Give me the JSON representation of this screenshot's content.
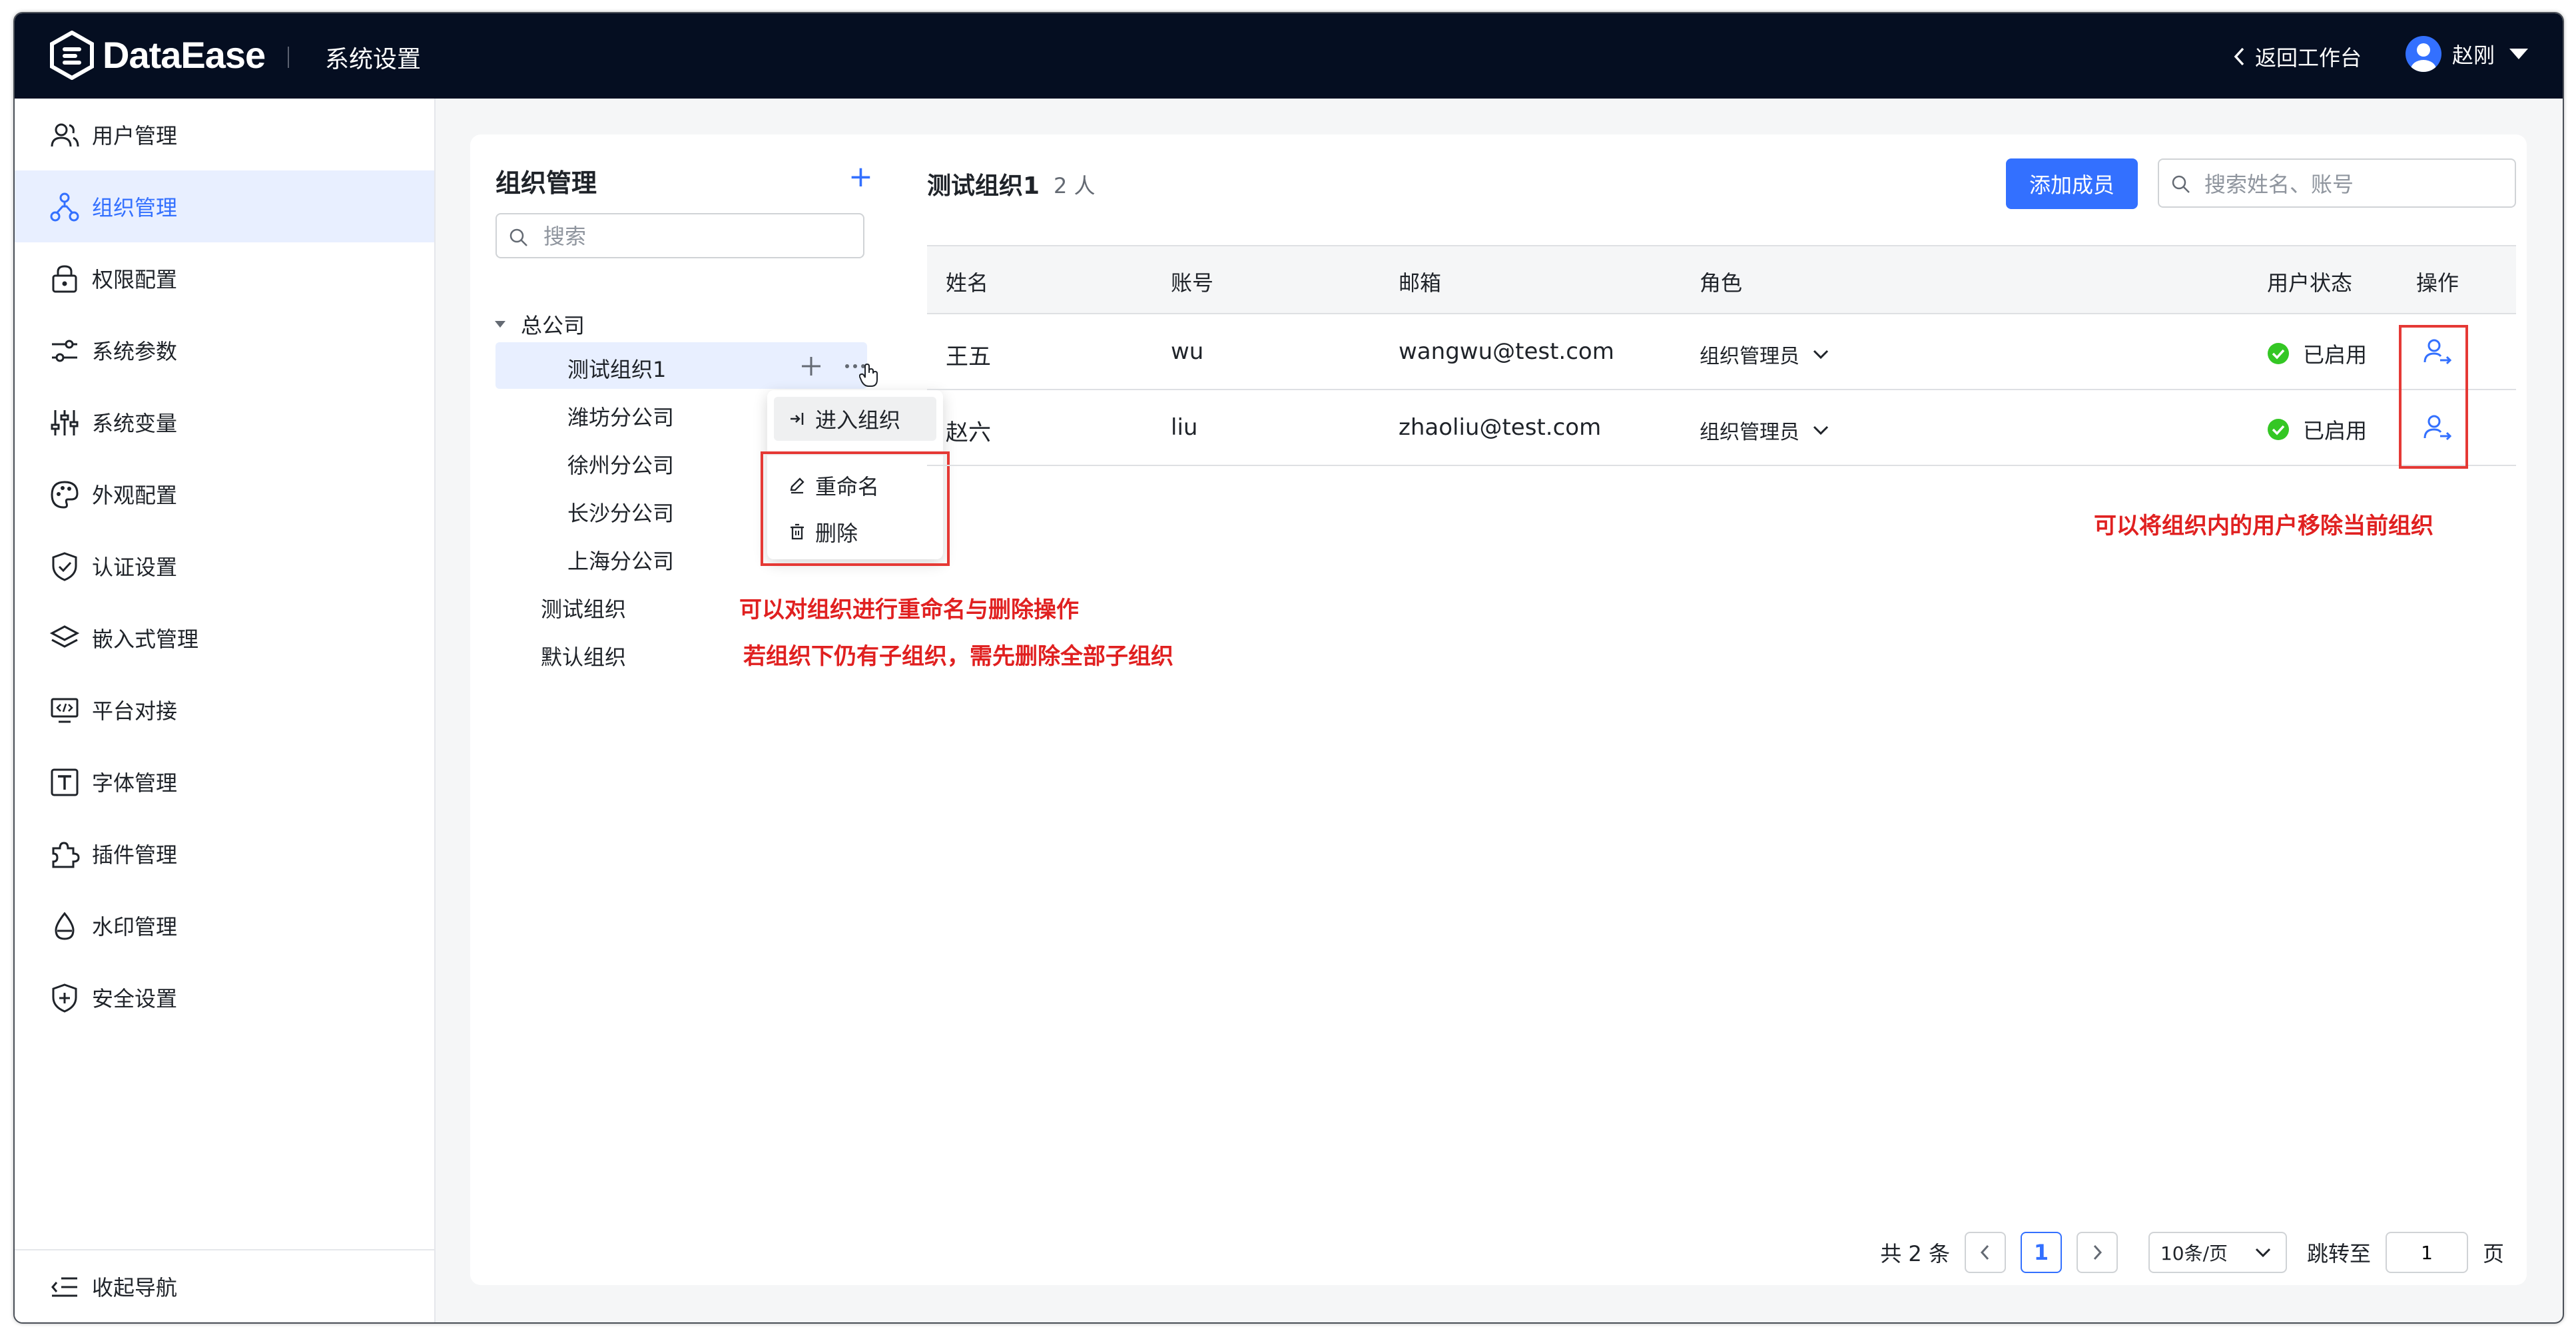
{
  "app": {
    "brand": "DataEase",
    "section_title": "系统设置",
    "back_label": "返回工作台",
    "user_name": "赵刚"
  },
  "sidebar": {
    "items": [
      {
        "label": "用户管理",
        "icon": "users-icon"
      },
      {
        "label": "组织管理",
        "icon": "org-tree-icon",
        "active": true
      },
      {
        "label": "权限配置",
        "icon": "lock-icon"
      },
      {
        "label": "系统参数",
        "icon": "sliders-icon"
      },
      {
        "label": "系统变量",
        "icon": "variables-icon"
      },
      {
        "label": "外观配置",
        "icon": "palette-icon"
      },
      {
        "label": "认证设置",
        "icon": "shield-check-icon"
      },
      {
        "label": "嵌入式管理",
        "icon": "layers-icon"
      },
      {
        "label": "平台对接",
        "icon": "monitor-code-icon"
      },
      {
        "label": "字体管理",
        "icon": "font-icon"
      },
      {
        "label": "插件管理",
        "icon": "puzzle-icon"
      },
      {
        "label": "水印管理",
        "icon": "droplet-icon"
      },
      {
        "label": "安全设置",
        "icon": "shield-plus-icon"
      }
    ],
    "collapse_label": "收起导航"
  },
  "org_tree": {
    "title": "组织管理",
    "add_symbol": "+",
    "search_placeholder": "搜索",
    "root": "总公司",
    "children": [
      "测试组织1",
      "潍坊分公司",
      "徐州分公司",
      "长沙分公司",
      "上海分公司"
    ],
    "others": [
      "测试组织",
      "默认组织"
    ]
  },
  "context_menu": {
    "enter": "进入组织",
    "rename": "重命名",
    "delete": "删除"
  },
  "annotations": {
    "rename_delete": "可以对组织进行重命名与删除操作",
    "delete_children": "若组织下仍有子组织，需先删除全部子组织",
    "remove_user": "可以将组织内的用户移除当前组织"
  },
  "member_panel": {
    "group_name": "测试组织1",
    "member_count": "2 人",
    "add_button": "添加成员",
    "search_placeholder": "搜索姓名、账号",
    "columns": [
      "姓名",
      "账号",
      "邮箱",
      "角色",
      "用户状态",
      "操作"
    ],
    "rows": [
      {
        "name": "王五",
        "account": "wu",
        "email": "wangwu@test.com",
        "role": "组织管理员",
        "status": "已启用"
      },
      {
        "name": "赵六",
        "account": "liu",
        "email": "zhaoliu@test.com",
        "role": "组织管理员",
        "status": "已启用"
      }
    ]
  },
  "pagination": {
    "total": "共 2 条",
    "current_page": "1",
    "page_size": "10条/页",
    "jump_label": "跳转至",
    "jump_value": "1",
    "page_unit": "页"
  },
  "colors": {
    "accent": "#3370ff",
    "topbar": "#050e21",
    "annotation_red": "#e02020",
    "status_green": "#34c724"
  }
}
